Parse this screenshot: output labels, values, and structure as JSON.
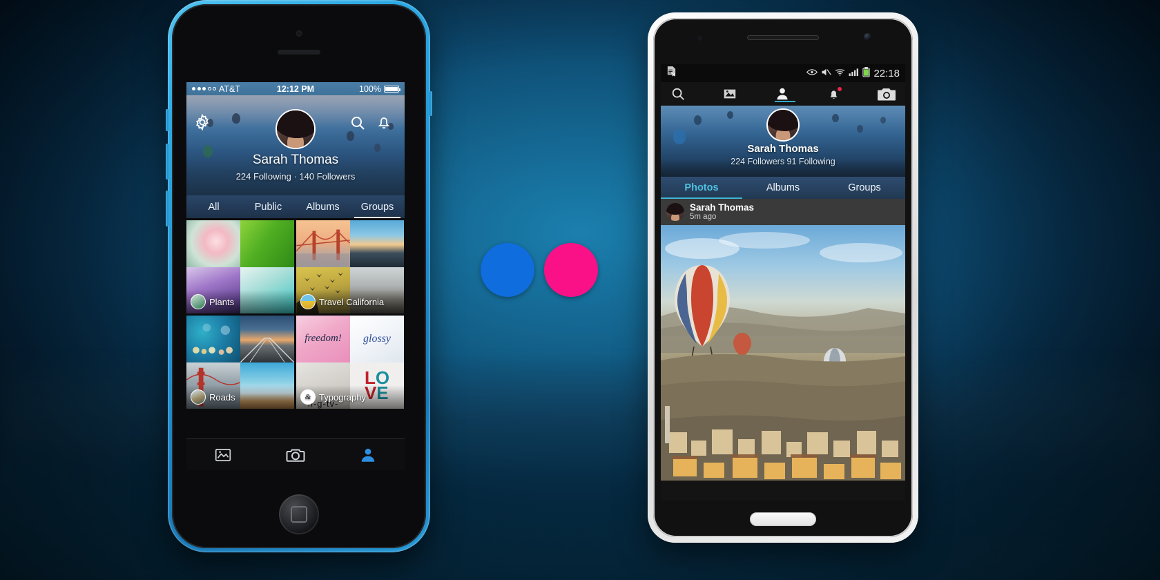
{
  "scene": {
    "title": "Flickr mobile app on iPhone 5c and Android phone",
    "accent_blue": "#0f6ddd",
    "accent_pink": "#fa1187"
  },
  "center_dots": [
    {
      "name": "blue-dot",
      "color": "#0f6ddd"
    },
    {
      "name": "pink-dot",
      "color": "#fa1187"
    }
  ],
  "iphone": {
    "status_bar": {
      "carrier": "AT&T",
      "time": "12:12 PM",
      "battery": "100%"
    },
    "header": {
      "gear_icon": "gear-icon",
      "search_icon": "search-icon",
      "bell_icon": "bell-icon",
      "username": "Sarah Thomas",
      "stats": "224 Following  ·  140 Followers"
    },
    "tabs": [
      {
        "label": "All",
        "selected": false
      },
      {
        "label": "Public",
        "selected": false
      },
      {
        "label": "Albums",
        "selected": false
      },
      {
        "label": "Groups",
        "selected": true
      }
    ],
    "albums": [
      {
        "label": "Plants",
        "icon": "plants-album-icon",
        "tiles": [
          "pink-blossom",
          "green-leaf",
          "lavender-field",
          "white-mist"
        ]
      },
      {
        "label": "Travel California",
        "icon": "travel-album-icon",
        "tiles": [
          "golden-gate-bridge",
          "sunset-lake",
          "birds-yellow-sky",
          "desert-cliff"
        ]
      },
      {
        "label": "Roads",
        "icon": "roads-album-icon",
        "tiles": [
          "bokeh-lights",
          "railway-tracks",
          "bridge-tower",
          "sky-road"
        ]
      },
      {
        "label": "Typography",
        "icon": "typography-album-icon",
        "tiles": [
          "freedom-pink",
          "glossy-text",
          "negative-text",
          "love-text"
        ]
      }
    ],
    "tabbar": [
      {
        "name": "feed-tab",
        "icon": "photo-feed-icon",
        "active": false
      },
      {
        "name": "camera-tab",
        "icon": "camera-icon",
        "active": false
      },
      {
        "name": "profile-tab",
        "icon": "person-icon",
        "active": true
      }
    ]
  },
  "android": {
    "status_bar": {
      "left_icon": "no-sim-document-icon",
      "icons": [
        "eye-icon",
        "mute-icon",
        "wifi-icon",
        "signal-icon",
        "battery-icon"
      ],
      "time": "22:18"
    },
    "action_bar": [
      {
        "name": "search-icon",
        "selected": false
      },
      {
        "name": "photos-icon",
        "selected": false
      },
      {
        "name": "person-icon",
        "selected": true
      },
      {
        "name": "bell-icon",
        "selected": false,
        "badge": true
      },
      {
        "name": "camera-icon",
        "selected": false
      }
    ],
    "header": {
      "username": "Sarah Thomas",
      "stats": "224 Followers 91 Following"
    },
    "tabs": [
      {
        "label": "Photos",
        "selected": true
      },
      {
        "label": "Albums",
        "selected": false
      },
      {
        "label": "Groups",
        "selected": false
      }
    ],
    "post": {
      "author": "Sarah Thomas",
      "time": "5m ago",
      "photo": "hot-air-balloons-over-cappadocia"
    }
  }
}
